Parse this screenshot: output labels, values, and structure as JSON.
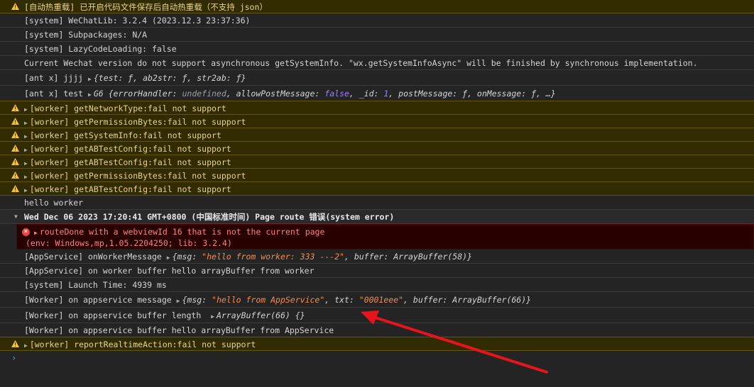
{
  "rows": {
    "r1": "[自动热重载] 已开启代码文件保存后自动热重载（不支持 json）",
    "r2": "[system] WeChatLib: 3.2.4 (2023.12.3 23:37:36)",
    "r3": "[system] Subpackages: N/A",
    "r4": "[system] LazyCodeLoading: false",
    "r5": "Current Wechat version do not support asynchronous getSystemInfo. \"wx.getSystemInfoAsync\" will be finished by synchronous implementation.",
    "r6_prefix": "[ant x] jjjj ",
    "r6_obj": "{test: ƒ, ab2str: ƒ, str2ab: ƒ}",
    "r7_prefix": "[ant x] test ",
    "r7_obj_a": "G6 {errorHandler: ",
    "r7_undef": "undefined",
    "r7_obj_b": ", allowPostMessage: ",
    "r7_false": "false",
    "r7_obj_c": ", _id: ",
    "r7_one": "1",
    "r7_obj_d": ", postMessage: ƒ, onMessage: ƒ, …}",
    "w1": "[worker] getNetworkType:fail not support",
    "w2": "[worker] getPermissionBytes:fail not support",
    "w3": "[worker] getSystemInfo:fail not support",
    "w4": "[worker] getABTestConfig:fail not support",
    "w5": "[worker] getABTestConfig:fail not support",
    "w6": "[worker] getPermissionBytes:fail not support",
    "w7": "[worker] getABTestConfig:fail not support",
    "hello": "hello worker",
    "group": "Wed Dec 06 2023 17:20:41 GMT+0800 (中国标准时间) Page route 错误(system error)",
    "err1": "routeDone with a webviewId 16 that is not the current page",
    "err2": "(env: Windows,mp,1.05.2204250; lib: 3.2.4)",
    "a1_prefix": "[AppService] onWorkerMessage ",
    "a1_o1": "{msg: ",
    "a1_s1": "\"hello from worker: 333 ---2\"",
    "a1_o2": ", buffer: ArrayBuffer(58)}",
    "a2": "[AppService] on worker buffer hello arrayBuffer from worker",
    "a3": "[system] Launch Time: 4939 ms",
    "a4_prefix": "[Worker] on appservice message ",
    "a4_o1": "{msg: ",
    "a4_s1": "\"hello from AppService\"",
    "a4_o2": ", txt: ",
    "a4_s2": "\"0001eee\"",
    "a4_o3": ", buffer: ArrayBuffer(66)}",
    "a5_prefix": "[Worker] on appservice buffer length  ",
    "a5_obj": "ArrayBuffer(66) {}",
    "a6": "[Worker] on appservice buffer hello arrayBuffer from AppService",
    "w8": "[worker] reportRealtimeAction:fail not support"
  },
  "colors": {
    "warning_bg": "#332b00",
    "warning_text": "#e5d58a",
    "error_bg": "#290000",
    "error_text": "#ff8080",
    "string": "#f28b54",
    "annotation_arrow": "#e8141b"
  },
  "icons": {
    "warning": "warning-triangle-icon",
    "error": "error-circle-icon",
    "expand": "expand-triangle-icon",
    "prompt": "chevron-right-icon"
  },
  "prompt_symbol": "›"
}
